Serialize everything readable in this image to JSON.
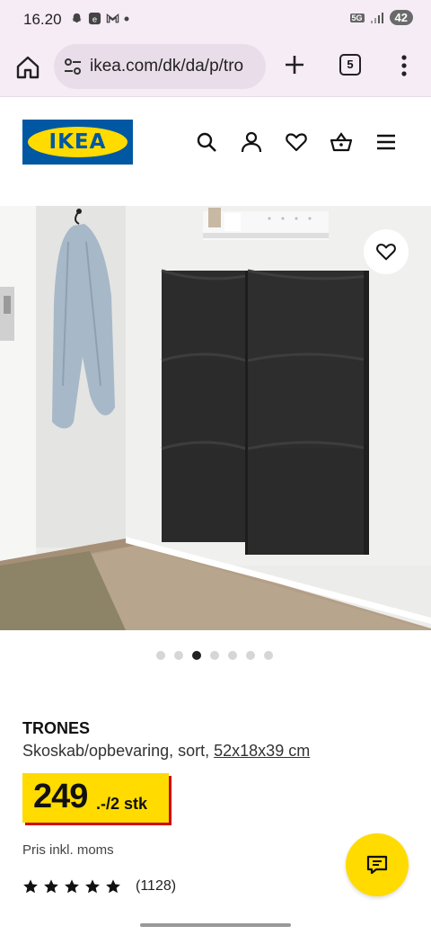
{
  "status_bar": {
    "time": "16.20",
    "network": "5G",
    "battery": "42"
  },
  "browser": {
    "url": "ikea.com/dk/da/p/tro",
    "tab_count": "5"
  },
  "header": {
    "logo_text": "IKEA",
    "brand_blue": "#0058a3",
    "brand_yellow": "#ffdb00"
  },
  "icons": {
    "header": [
      "search-icon",
      "account-icon",
      "heart-icon",
      "basket-icon",
      "hamburger-menu-icon"
    ],
    "favourite": "heart-icon",
    "chat": "chat-icon"
  },
  "carousel": {
    "total": 7,
    "active_index": 2
  },
  "product": {
    "name": "TRONES",
    "description": "Skoskab/opbevaring, sort,",
    "dimensions": "52x18x39 cm",
    "price_integer": "249",
    "price_suffix": ".-/2 stk",
    "vat_note": "Pris inkl. moms",
    "rating_stars": 5,
    "rating_count": "(1128)"
  }
}
